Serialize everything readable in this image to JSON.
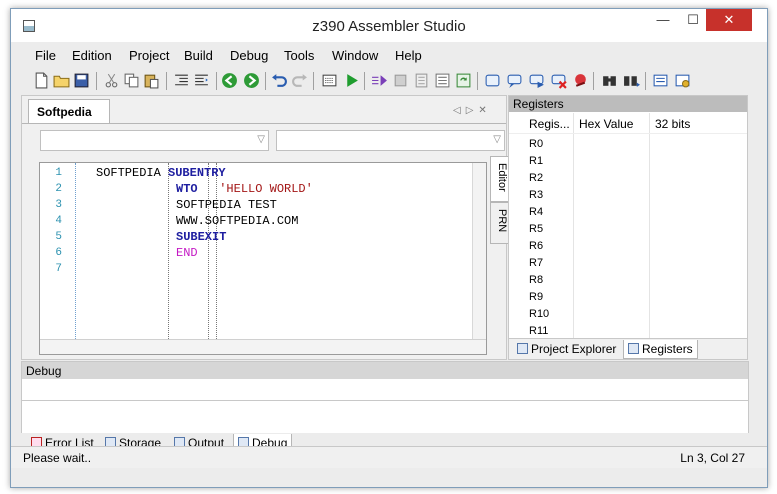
{
  "window": {
    "title": "z390 Assembler Studio"
  },
  "menu": [
    {
      "label": "File"
    },
    {
      "label": "Edition"
    },
    {
      "label": "Project"
    },
    {
      "label": "Build"
    },
    {
      "label": "Debug"
    },
    {
      "label": "Tools"
    },
    {
      "label": "Window"
    },
    {
      "label": "Help"
    }
  ],
  "toolbar_icons": [
    "new-file-icon",
    "open-folder-icon",
    "save-icon",
    "cut-icon",
    "copy-icon",
    "paste-icon",
    "indent-icon",
    "outdent-icon",
    "navigate-back-icon",
    "navigate-forward-icon",
    "undo-icon",
    "redo-icon",
    "assemble-icon",
    "run-icon",
    "step-icon",
    "stop-icon",
    "trace-icon",
    "refresh-icon",
    "window-icon",
    "breakpoint-add-icon",
    "breakpoint-next-icon",
    "breakpoint-remove-icon",
    "breakpoint-clear-icon",
    "find-icon",
    "find-next-icon",
    "list-icon",
    "options-icon"
  ],
  "editor": {
    "tab_label": "Softpedia",
    "line_numbers": [
      "1",
      "2",
      "3",
      "4",
      "5",
      "6",
      "7"
    ],
    "code": [
      {
        "label": "SOFTPEDIA",
        "op": "SUBENTRY",
        "operand": ""
      },
      {
        "label": "",
        "op": "WTO",
        "operand": "'HELLO WORLD'"
      },
      {
        "label": "",
        "op": "SOFTPEDIA TEST",
        "operand": ""
      },
      {
        "label": "",
        "op": "WWW.SOFTPEDIA.COM",
        "operand": ""
      },
      {
        "label": "",
        "op": "SUBEXIT",
        "operand": ""
      },
      {
        "label": "",
        "op": "END",
        "operand": ""
      },
      {
        "label": "",
        "op": "",
        "operand": ""
      }
    ],
    "side_tabs": [
      "Editor",
      "PRN"
    ]
  },
  "registers": {
    "header": "Registers",
    "columns": [
      "Regis...",
      "Hex Value",
      "32 bits"
    ],
    "rows": [
      "R0",
      "R1",
      "R2",
      "R3",
      "R4",
      "R5",
      "R6",
      "R7",
      "R8",
      "R9",
      "R10",
      "R11"
    ],
    "tabs": [
      "Project Explorer",
      "Registers"
    ]
  },
  "debug": {
    "header": "Debug",
    "tabs": [
      "Error List",
      "Storage",
      "Output",
      "Debug"
    ]
  },
  "status": {
    "left": "Please wait..",
    "right": "Ln 3, Col 27"
  },
  "colors": {
    "keyword": "#1e1ea0",
    "string": "#a31515",
    "end_keyword": "#c418c4",
    "line_number": "#2b91af",
    "close_button": "#c7312b"
  }
}
